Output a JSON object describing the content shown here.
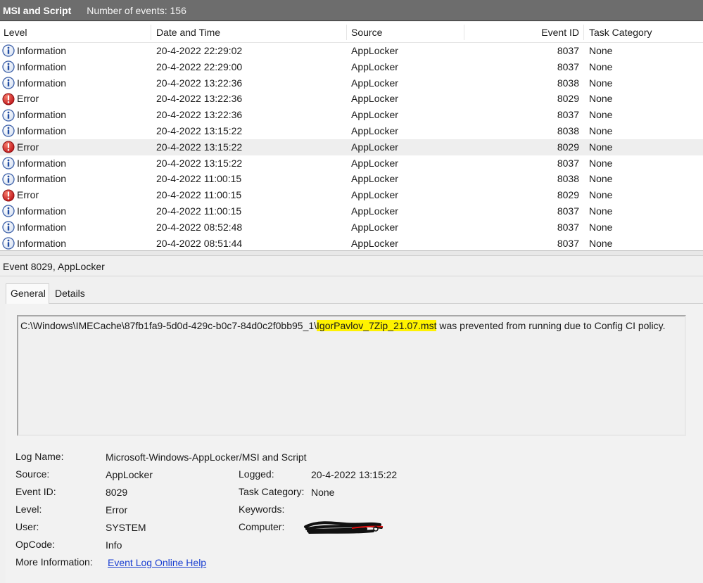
{
  "window": {
    "title": "MSI and Script",
    "event_count": "Number of events: 156"
  },
  "columns": {
    "level": "Level",
    "date": "Date and Time",
    "source": "Source",
    "event_id": "Event ID",
    "task_category": "Task Category"
  },
  "rows": [
    {
      "icon": "info-icon",
      "level": "Information",
      "date": "20-4-2022 22:29:02",
      "source": "AppLocker",
      "id": "8037",
      "cat": "None"
    },
    {
      "icon": "info-icon",
      "level": "Information",
      "date": "20-4-2022 22:29:00",
      "source": "AppLocker",
      "id": "8037",
      "cat": "None"
    },
    {
      "icon": "info-icon",
      "level": "Information",
      "date": "20-4-2022 13:22:36",
      "source": "AppLocker",
      "id": "8038",
      "cat": "None"
    },
    {
      "icon": "error-icon",
      "level": "Error",
      "date": "20-4-2022 13:22:36",
      "source": "AppLocker",
      "id": "8029",
      "cat": "None"
    },
    {
      "icon": "info-icon",
      "level": "Information",
      "date": "20-4-2022 13:22:36",
      "source": "AppLocker",
      "id": "8037",
      "cat": "None"
    },
    {
      "icon": "info-icon",
      "level": "Information",
      "date": "20-4-2022 13:15:22",
      "source": "AppLocker",
      "id": "8038",
      "cat": "None"
    },
    {
      "icon": "error-icon",
      "level": "Error",
      "date": "20-4-2022 13:15:22",
      "source": "AppLocker",
      "id": "8029",
      "cat": "None",
      "selected": true
    },
    {
      "icon": "info-icon",
      "level": "Information",
      "date": "20-4-2022 13:15:22",
      "source": "AppLocker",
      "id": "8037",
      "cat": "None"
    },
    {
      "icon": "info-icon",
      "level": "Information",
      "date": "20-4-2022 11:00:15",
      "source": "AppLocker",
      "id": "8038",
      "cat": "None"
    },
    {
      "icon": "error-icon",
      "level": "Error",
      "date": "20-4-2022 11:00:15",
      "source": "AppLocker",
      "id": "8029",
      "cat": "None"
    },
    {
      "icon": "info-icon",
      "level": "Information",
      "date": "20-4-2022 11:00:15",
      "source": "AppLocker",
      "id": "8037",
      "cat": "None"
    },
    {
      "icon": "info-icon",
      "level": "Information",
      "date": "20-4-2022 08:52:48",
      "source": "AppLocker",
      "id": "8037",
      "cat": "None"
    },
    {
      "icon": "info-icon",
      "level": "Information",
      "date": "20-4-2022 08:51:44",
      "source": "AppLocker",
      "id": "8037",
      "cat": "None"
    }
  ],
  "detail": {
    "header": "Event 8029, AppLocker",
    "tabs": [
      "General",
      "Details"
    ],
    "message_prefix": "C:\\Windows\\IMECache\\87fb1fa9-5d0d-429c-b0c7-84d0c2f0bb95_1\\",
    "message_highlight": "IgorPavlov_7Zip_21.07.mst",
    "message_suffix": " was prevented from running due to Config CI policy.",
    "highlight_color": "#fff200",
    "labels": {
      "log_name": "Log Name:",
      "source": "Source:",
      "event_id": "Event ID:",
      "level": "Level:",
      "user": "User:",
      "opcode": "OpCode:",
      "more_info": "More Information:",
      "logged": "Logged:",
      "task_category": "Task Category:",
      "keywords": "Keywords:",
      "computer": "Computer:"
    },
    "values": {
      "log_name": "Microsoft-Windows-AppLocker/MSI and Script",
      "source": "AppLocker",
      "event_id": "8029",
      "level": "Error",
      "user": "SYSTEM",
      "opcode": "Info",
      "more_info_link": "Event Log Online Help",
      "logged": "20-4-2022 13:15:22",
      "task_category": "None",
      "keywords": "",
      "computer": ""
    }
  }
}
